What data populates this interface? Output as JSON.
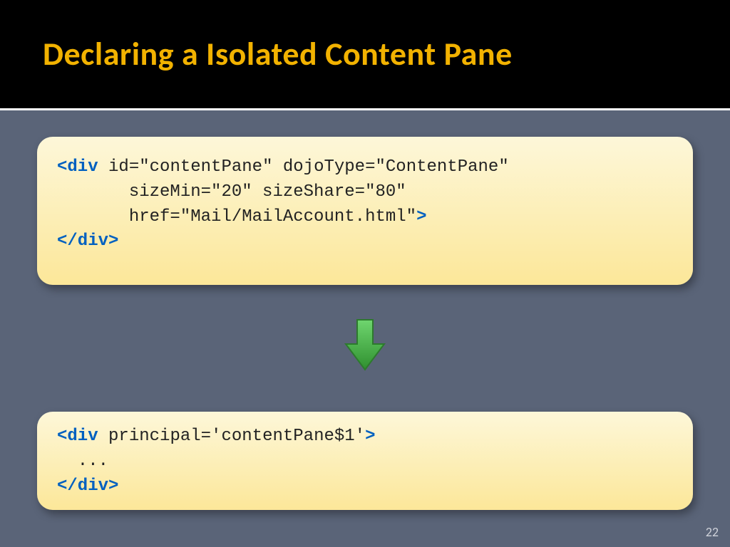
{
  "title": "Declaring a Isolated Content Pane",
  "code1": {
    "openAngle": "<",
    "tag": "div",
    "attrsLine1": " id=\"contentPane\" dojoType=\"ContentPane\"",
    "attrsLine2": "       sizeMin=\"20\" sizeShare=\"80\"",
    "attrsLine3": "       href=\"Mail/MailAccount.html\"",
    "closeAngle": ">",
    "closeTag": "</div>"
  },
  "code2": {
    "openAngle": "<",
    "tag": "div",
    "attrs": " principal='contentPane$1'",
    "closeAngle": ">",
    "body": "  ...",
    "closeTag": "</div>"
  },
  "pageNumber": "22",
  "arrowColor": "#3fa83f",
  "arrowStroke": "#2d7a2d"
}
